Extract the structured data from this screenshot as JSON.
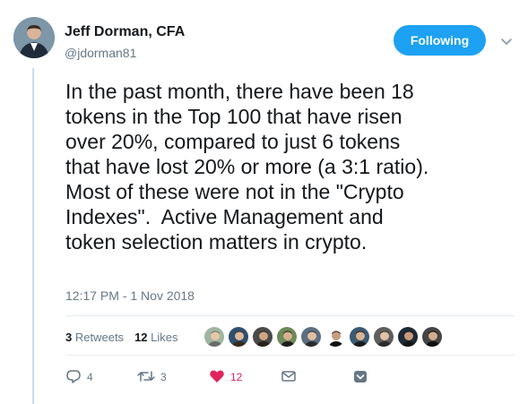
{
  "author": {
    "name": "Jeff Dorman, CFA",
    "handle": "@jdorman81"
  },
  "follow_button": {
    "label": "Following",
    "color": "#1da1f2"
  },
  "tweet": {
    "text": "In the past month, there have been 18\ntokens in the Top 100 that have risen\nover 20%, compared to just 6 tokens\nthat have lost 20% or more (a 3:1 ratio).\nMost of these were not in the \"Crypto\nIndexes\".  Active Management and\ntoken selection matters in crypto.",
    "timestamp": "12:17 PM - 1 Nov 2018"
  },
  "stats": {
    "retweets_count": "3",
    "retweets_label": "Retweets",
    "likes_count": "12",
    "likes_label": "Likes"
  },
  "liker_avatars_count": 10,
  "actions": {
    "reply_count": "4",
    "retweet_count": "3",
    "like_count": "12",
    "like_color": "#e0245e"
  },
  "icons": [
    "reply-icon",
    "retweet-icon",
    "heart-icon",
    "message-icon",
    "share-icon",
    "chevron-down-icon"
  ]
}
